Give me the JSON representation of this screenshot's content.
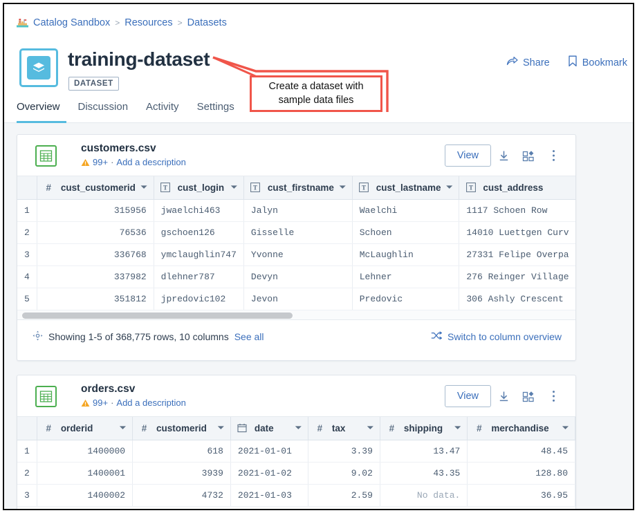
{
  "breadcrumb": {
    "icon": "sandcastle-icon",
    "items": [
      "Catalog Sandbox",
      "Resources",
      "Datasets"
    ],
    "separator": ">"
  },
  "header": {
    "title": "training-dataset",
    "badge": "DATASET",
    "logo_icon": "layers-stack-icon",
    "actions": [
      {
        "label": "Share",
        "icon": "share-arrow-icon"
      },
      {
        "label": "Bookmark",
        "icon": "bookmark-icon"
      }
    ]
  },
  "callout": {
    "line1": "Create a dataset with",
    "line2": "sample data files",
    "color": "#f0554a"
  },
  "tabs": [
    {
      "label": "Overview",
      "active": true
    },
    {
      "label": "Discussion",
      "active": false
    },
    {
      "label": "Activity",
      "active": false
    },
    {
      "label": "Settings",
      "active": false
    }
  ],
  "accent_color": "#56bbdf",
  "link_color": "#3b6fbb",
  "cards": [
    {
      "file_name": "customers.csv",
      "warning_count": "99+",
      "separator": "·",
      "add_description": "Add a description",
      "view_label": "View",
      "actions": [
        "download-icon",
        "add-to-collection-icon",
        "more-vertical-icon"
      ],
      "columns": [
        {
          "name": "cust_customerid",
          "type": "number",
          "type_glyph": "#"
        },
        {
          "name": "cust_login",
          "type": "text",
          "type_glyph": "T"
        },
        {
          "name": "cust_firstname",
          "type": "text",
          "type_glyph": "T"
        },
        {
          "name": "cust_lastname",
          "type": "text",
          "type_glyph": "T"
        },
        {
          "name": "cust_address",
          "type": "text",
          "type_glyph": "T"
        }
      ],
      "rows": [
        {
          "index": "1",
          "cells": [
            "315956",
            "jwaelchi463",
            "Jalyn",
            "Waelchi",
            "1117 Schoen Row"
          ]
        },
        {
          "index": "2",
          "cells": [
            "76536",
            "gschoen126",
            "Gisselle",
            "Schoen",
            "14010 Luettgen Curv"
          ]
        },
        {
          "index": "3",
          "cells": [
            "336768",
            "ymclaughlin747",
            "Yvonne",
            "McLaughlin",
            "27331 Felipe Overpa"
          ]
        },
        {
          "index": "4",
          "cells": [
            "337982",
            "dlehner787",
            "Devyn",
            "Lehner",
            "276 Reinger Village"
          ]
        },
        {
          "index": "5",
          "cells": [
            "351812",
            "jpredovic102",
            "Jevon",
            "Predovic",
            "306 Ashly Crescent"
          ]
        }
      ],
      "footer": {
        "showing": "Showing 1-5 of 368,775 rows, 10 columns",
        "see_all": "See all",
        "switch": "Switch to column overview"
      }
    },
    {
      "file_name": "orders.csv",
      "warning_count": "99+",
      "separator": "·",
      "add_description": "Add a description",
      "view_label": "View",
      "actions": [
        "download-icon",
        "add-to-collection-icon",
        "more-vertical-icon"
      ],
      "columns": [
        {
          "name": "orderid",
          "type": "number",
          "type_glyph": "#"
        },
        {
          "name": "customerid",
          "type": "number",
          "type_glyph": "#"
        },
        {
          "name": "date",
          "type": "date",
          "type_glyph": "cal"
        },
        {
          "name": "tax",
          "type": "number",
          "type_glyph": "#"
        },
        {
          "name": "shipping",
          "type": "number",
          "type_glyph": "#"
        },
        {
          "name": "merchandise",
          "type": "number",
          "type_glyph": "#"
        }
      ],
      "rows": [
        {
          "index": "1",
          "cells": [
            "1400000",
            "618",
            "2021-01-01",
            "3.39",
            "13.47",
            "48.45"
          ]
        },
        {
          "index": "2",
          "cells": [
            "1400001",
            "3939",
            "2021-01-02",
            "9.02",
            "43.35",
            "128.80"
          ]
        },
        {
          "index": "3",
          "cells": [
            "1400002",
            "4732",
            "2021-01-03",
            "2.59",
            "No data.",
            "36.95"
          ]
        }
      ]
    }
  ]
}
